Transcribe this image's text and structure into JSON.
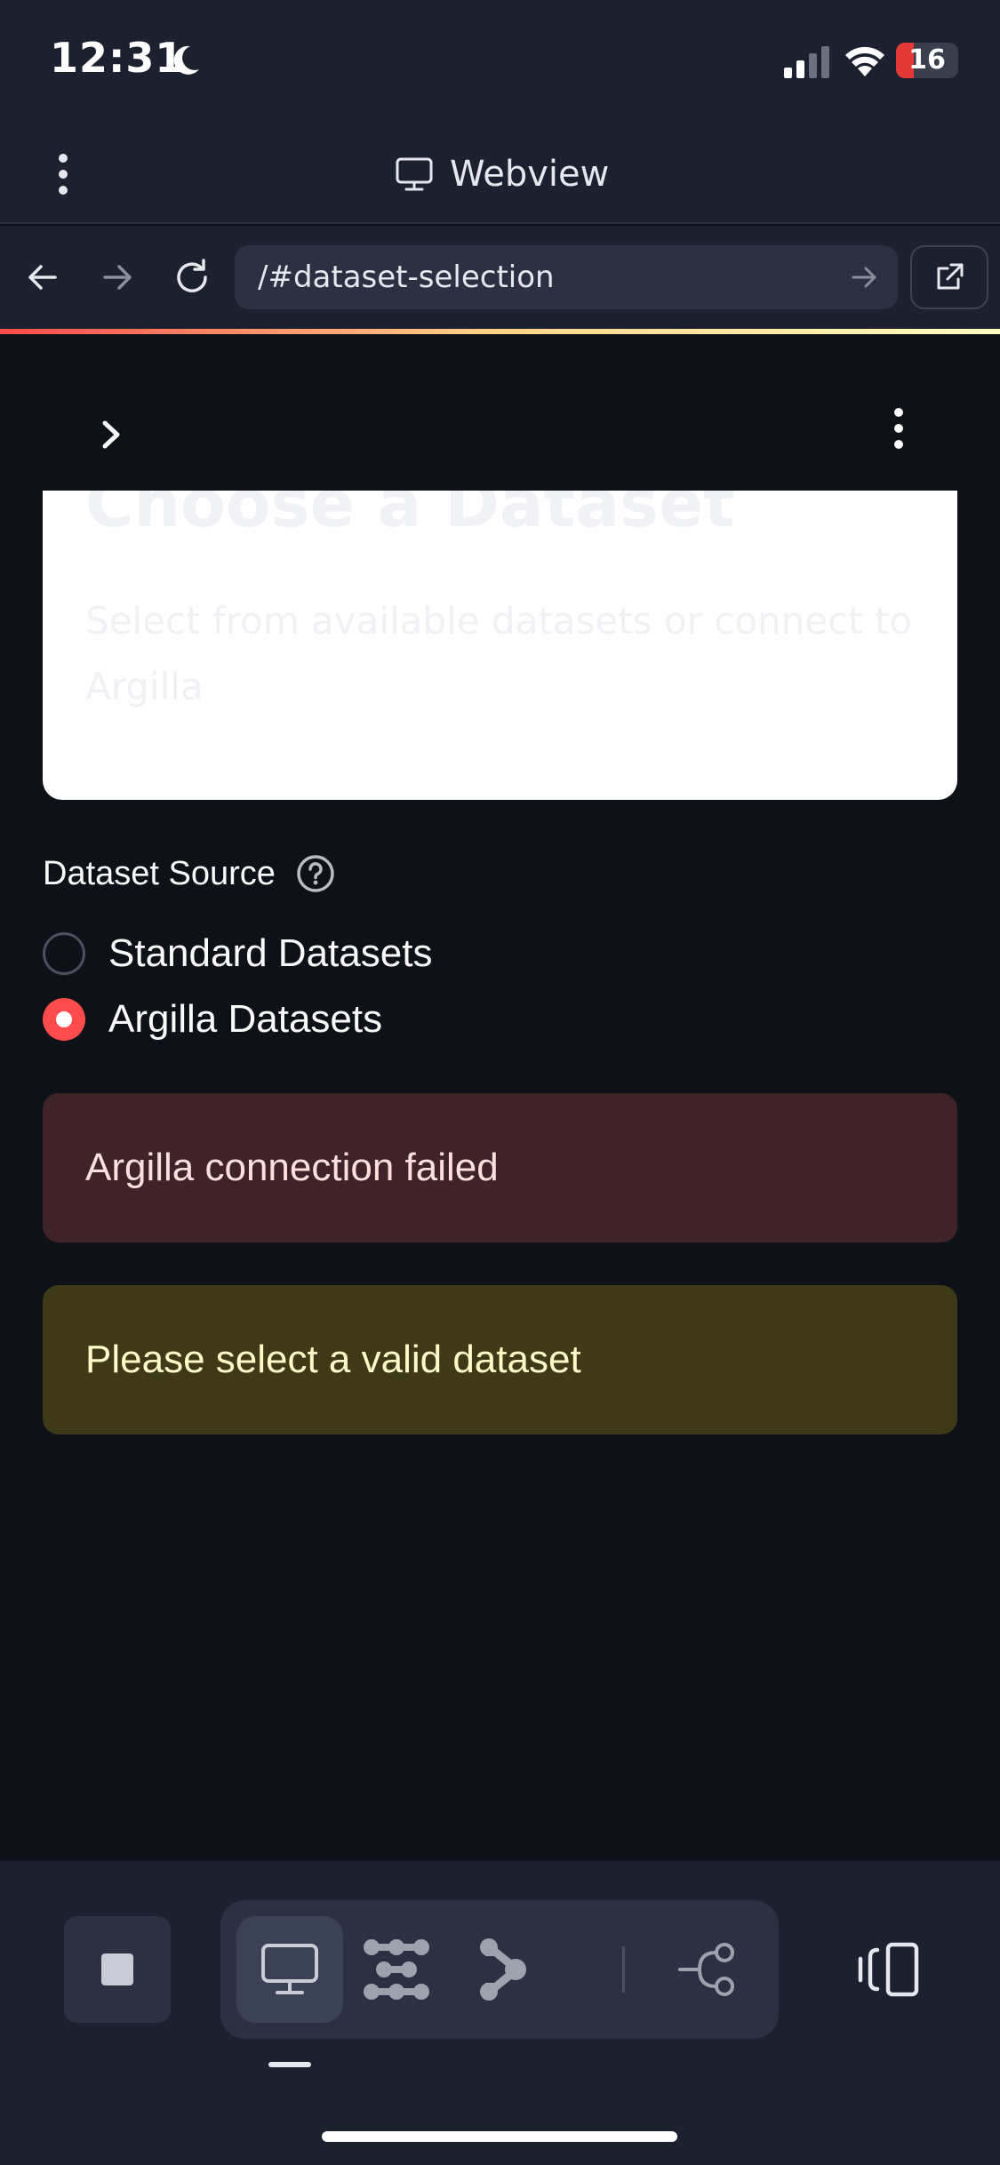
{
  "status_bar": {
    "time": "12:31",
    "battery": "16"
  },
  "header": {
    "title": "Webview"
  },
  "nav": {
    "url": "/#dataset-selection"
  },
  "card": {
    "title": "Choose a Dataset",
    "subtitle": "Select from available datasets or connect to Argilla"
  },
  "form": {
    "label": "Dataset Source",
    "options": [
      {
        "label": "Standard Datasets",
        "selected": false
      },
      {
        "label": "Argilla Datasets",
        "selected": true
      }
    ]
  },
  "alerts": {
    "error": "Argilla connection failed",
    "warning": "Please select a valid dataset"
  },
  "colors": {
    "accent": "#ff4b4b",
    "background": "#0e1117",
    "error_bg": "#3e2329",
    "warning_bg": "#3e3a18"
  },
  "icons": {
    "status": [
      "moon-icon",
      "signal-icon",
      "wifi-icon",
      "battery-icon"
    ],
    "header": [
      "more-vertical-icon",
      "monitor-icon"
    ],
    "nav": [
      "back-arrow-icon",
      "forward-arrow-icon",
      "reload-icon",
      "go-arrow-icon",
      "external-link-icon"
    ],
    "toolbar": [
      "stop-icon",
      "monitor-icon",
      "network-icon",
      "branch-icon",
      "share-icon",
      "phone-rotate-icon"
    ]
  }
}
